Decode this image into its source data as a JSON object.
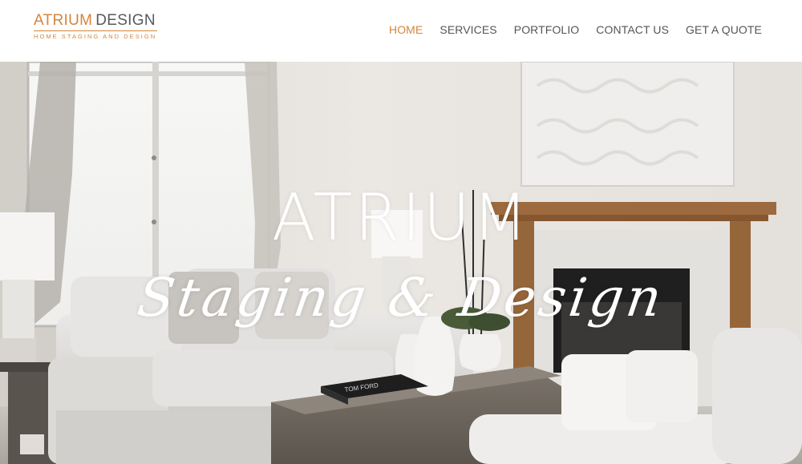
{
  "header": {
    "logo": {
      "primary": "ATRIUM",
      "secondary": "DESIGN",
      "tagline": "HOME STAGING AND DESIGN"
    },
    "nav": [
      {
        "label": "HOME",
        "active": true
      },
      {
        "label": "SERVICES",
        "active": false
      },
      {
        "label": "PORTFOLIO",
        "active": false
      },
      {
        "label": "CONTACT US",
        "active": false
      },
      {
        "label": "GET A QUOTE",
        "active": false
      }
    ]
  },
  "hero": {
    "title": "ATRIUM",
    "subtitle": "Staging & Design",
    "book_label": "TOM FORD",
    "image": "living-room-photo"
  },
  "colors": {
    "accent": "#d4853c",
    "nav_text": "#555555",
    "hero_text": "#ffffff"
  }
}
